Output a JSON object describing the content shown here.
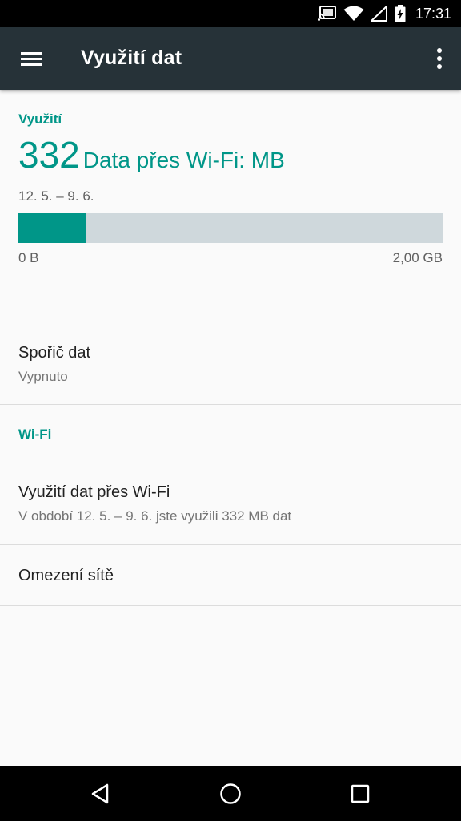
{
  "status_bar": {
    "time": "17:31",
    "icons": [
      "cast-icon",
      "wifi-icon",
      "signal-empty-icon",
      "battery-charging-icon"
    ]
  },
  "app_bar": {
    "title": "Využití dat",
    "left_icon": "menu-icon",
    "right_icon": "more-vert-icon"
  },
  "usage_section": {
    "header": "Využití",
    "amount": "332",
    "amount_label": "Data přes Wi-Fi: MB",
    "period": "12. 5. – 9. 6.",
    "bar_min_label": "0 B",
    "bar_max_label": "2,00 GB",
    "bar_fill_fraction": 0.16
  },
  "data_saver": {
    "title": "Spořič dat",
    "summary": "Vypnuto"
  },
  "wifi_section": {
    "header": "Wi-Fi",
    "items": [
      {
        "title": "Využití dat přes Wi-Fi",
        "summary": "V období 12. 5. – 9. 6. jste využili 332 MB dat"
      },
      {
        "title": "Omezení sítě"
      }
    ]
  },
  "nav_bar": {
    "icons": [
      "back-icon",
      "home-icon",
      "recents-icon"
    ]
  },
  "colors": {
    "accent": "#009688",
    "app_bar": "#263238",
    "bar_track": "#cfd8dc",
    "background": "#fafafa"
  }
}
